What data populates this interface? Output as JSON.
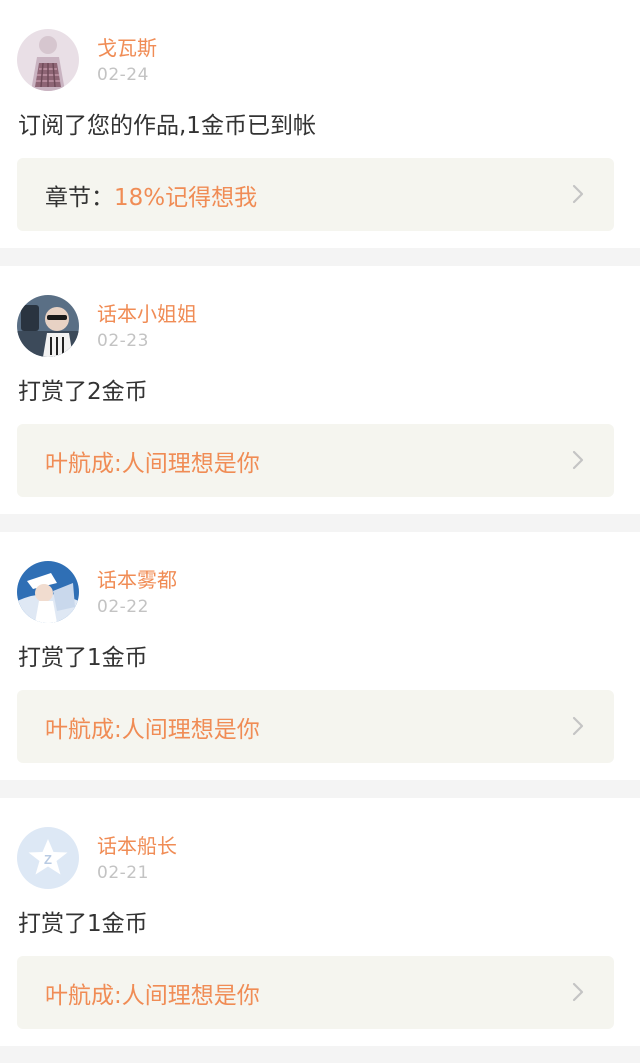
{
  "notifications": [
    {
      "user": "戈瓦斯",
      "date": "02-24",
      "message": "订阅了您的作品,1金币已到帐",
      "link_prefix": "章节：",
      "link_title": "18%记得想我"
    },
    {
      "user": "话本小姐姐",
      "date": "02-23",
      "message": "打赏了2金币",
      "link_prefix": "",
      "link_title": "叶航成:人间理想是你"
    },
    {
      "user": "话本雾都",
      "date": "02-22",
      "message": "打赏了1金币",
      "link_prefix": "",
      "link_title": "叶航成:人间理想是你"
    },
    {
      "user": "话本船长",
      "date": "02-21",
      "message": "打赏了1金币",
      "link_prefix": "",
      "link_title": "叶航成:人间理想是你"
    }
  ],
  "colors": {
    "accent": "#f08c55",
    "text": "#333333",
    "muted": "#c3c3c3",
    "link_bg": "#f5f5ef",
    "separator": "#f4f4f4"
  },
  "icons": {
    "chevron": "chevron-right-icon",
    "avatars": [
      "girl-photo-avatar",
      "sunglasses-photo-avatar",
      "anime-character-avatar",
      "default-star-avatar"
    ]
  }
}
